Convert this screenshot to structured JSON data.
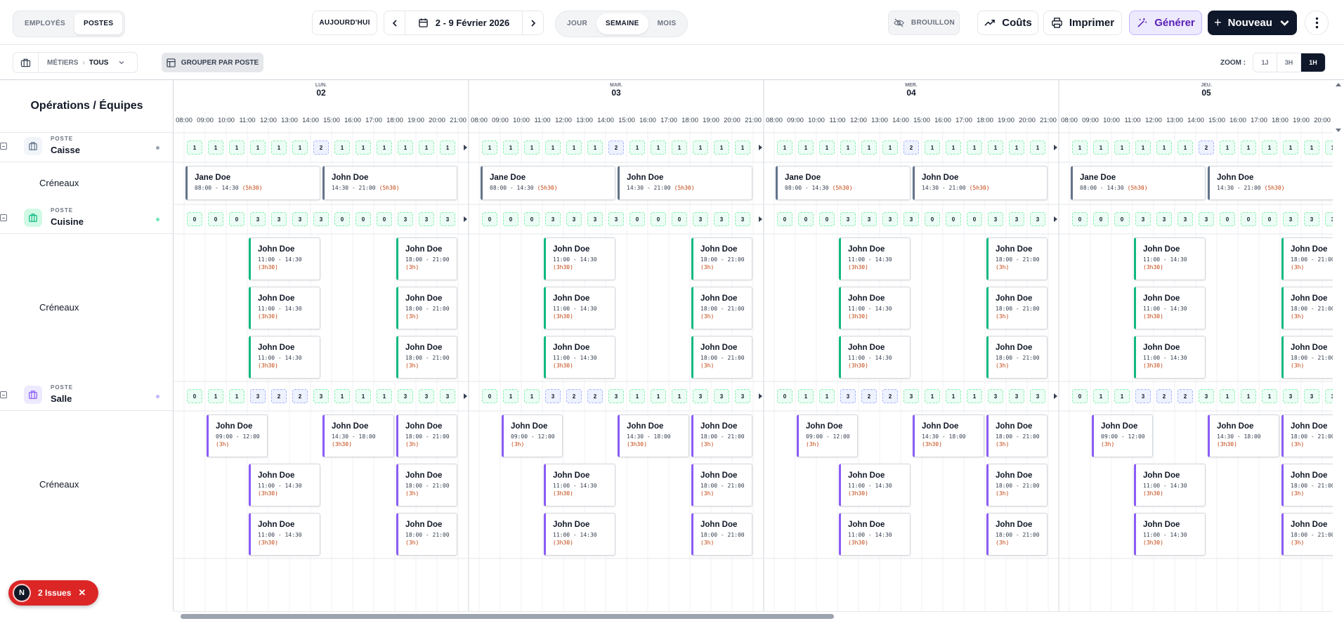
{
  "toolbar": {
    "view_toggle": [
      "EMPLOYÉS",
      "POSTES"
    ],
    "view_toggle_active": 1,
    "today_label": "AUJOURD'HUI",
    "date_range": "2 - 9 Février 2026",
    "period_toggle": [
      "JOUR",
      "SEMAINE",
      "MOIS"
    ],
    "period_toggle_active": 1,
    "draft_label": "BROUILLON",
    "costs_label": "Coûts",
    "print_label": "Imprimer",
    "generate_label": "Générer",
    "new_label": "Nouveau"
  },
  "filters": {
    "metiers_label": "MÉTIERS",
    "metiers_value": "TOUS",
    "group_label": "GROUPER PAR POSTE",
    "zoom_label": "ZOOM :",
    "zoom_options": [
      "1J",
      "3H",
      "1H"
    ],
    "zoom_active": 2
  },
  "grid": {
    "corner_title": "Opérations / Équipes",
    "days": [
      {
        "name": "LUN.",
        "num": "02"
      },
      {
        "name": "MAR.",
        "num": "03"
      },
      {
        "name": "MER.",
        "num": "04"
      },
      {
        "name": "JEU.",
        "num": "05"
      }
    ],
    "hours": [
      "08:00",
      "09:00",
      "10:00",
      "11:00",
      "12:00",
      "13:00",
      "14:00",
      "15:00",
      "16:00",
      "17:00",
      "18:00",
      "19:00",
      "20:00",
      "21:00"
    ],
    "slot_label": "Créneaux",
    "postes": [
      {
        "kicker": "POSTE",
        "name": "Caisse",
        "color": "#64748b",
        "icon_bg": "#f1f5f9",
        "dot": "#9ca3af",
        "icon": "briefcase-icon",
        "counts": [
          "1",
          "1",
          "1",
          "1",
          "1",
          "1",
          "2",
          "1",
          "1",
          "1",
          "1",
          "1",
          "1"
        ],
        "shifts": [
          {
            "name": "Jane Doe",
            "time": "08:00 - 14:30",
            "dur": "(5h30)"
          },
          {
            "name": "John Doe",
            "time": "14:30 - 21:00",
            "dur": "(5h30)"
          }
        ]
      },
      {
        "kicker": "POSTE",
        "name": "Cuisine",
        "color": "#10b981",
        "icon_bg": "#d1fae5",
        "dot": "#6ee7b7",
        "icon": "cutlery-icon",
        "counts": [
          "0",
          "0",
          "0",
          "3",
          "3",
          "3",
          "3",
          "0",
          "0",
          "0",
          "3",
          "3",
          "3"
        ],
        "shifts": [
          {
            "name": "John Doe",
            "time": "11:00 - 14:30",
            "dur": "(3h30)"
          },
          {
            "name": "John Doe",
            "time": "18:00 - 21:00",
            "dur": "(3h)"
          }
        ]
      },
      {
        "kicker": "POSTE",
        "name": "Salle",
        "color": "#8b5cf6",
        "icon_bg": "#ede9fe",
        "dot": "#c4b5fd",
        "icon": "briefcase-icon",
        "counts": [
          "0",
          "1",
          "1",
          "3",
          "2",
          "2",
          "3",
          "1",
          "1",
          "1",
          "3",
          "3",
          "3"
        ],
        "shifts": [
          {
            "name": "John Doe",
            "time": "09:00 - 12:00",
            "dur": "(3h)"
          },
          {
            "name": "John Doe",
            "time": "11:00 - 14:30",
            "dur": "(3h30)"
          },
          {
            "name": "John Doe",
            "time": "14:30 - 18:00",
            "dur": "(3h30)"
          },
          {
            "name": "John Doe",
            "time": "18:00 - 21:00",
            "dur": "(3h)"
          }
        ]
      }
    ]
  },
  "issues": {
    "badge": "N",
    "label": "2 Issues"
  }
}
